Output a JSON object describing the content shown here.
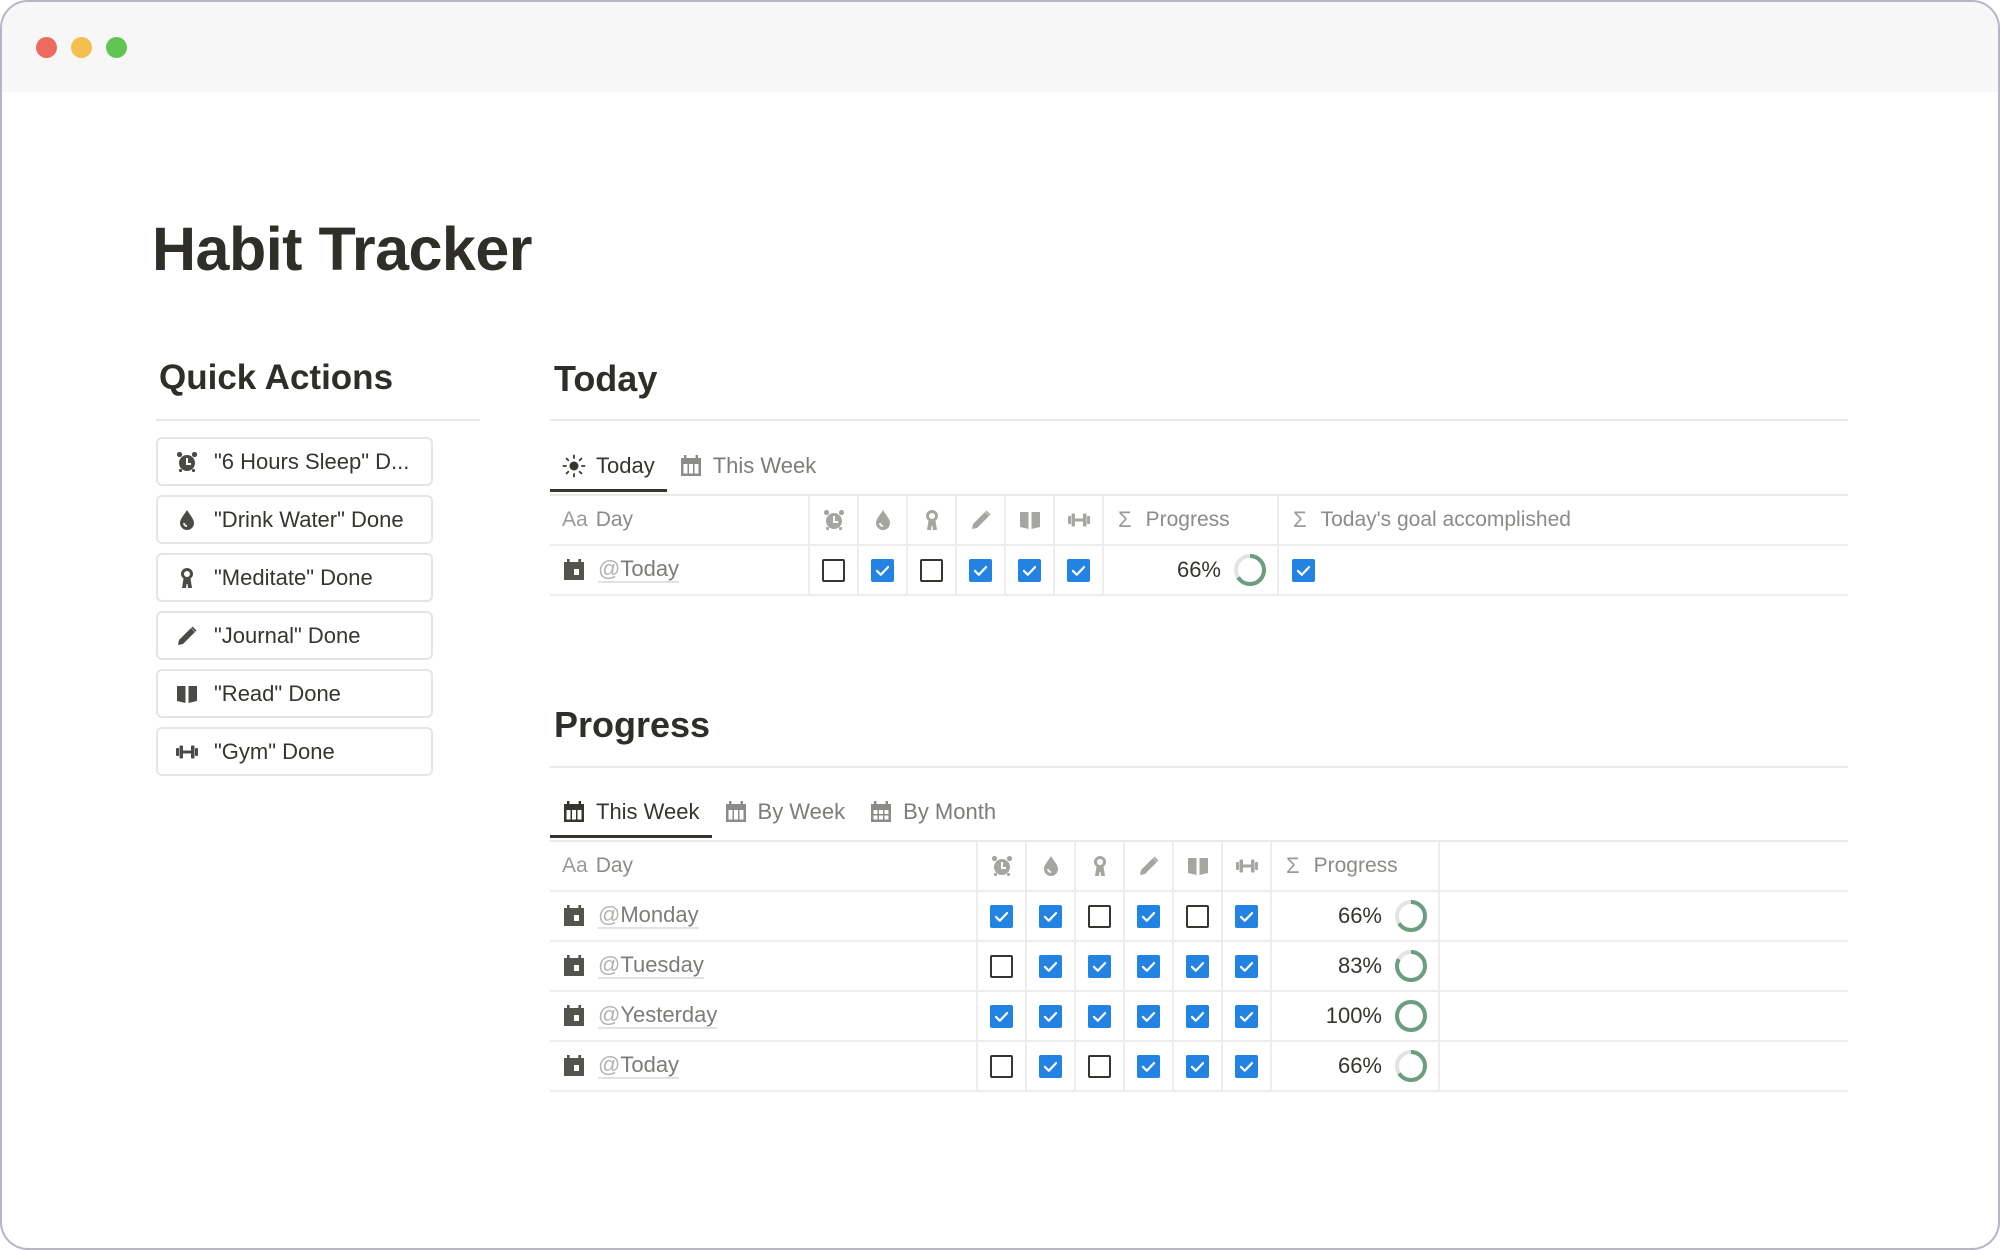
{
  "window": {
    "controls": [
      "close",
      "minimize",
      "maximize"
    ]
  },
  "page": {
    "title": "Habit Tracker"
  },
  "quick_actions": {
    "heading": "Quick Actions",
    "buttons": [
      {
        "label": "\"6 Hours Sleep\" D...",
        "icon": "alarm-clock-icon"
      },
      {
        "label": "\"Drink Water\" Done",
        "icon": "water-drop-icon"
      },
      {
        "label": "\"Meditate\" Done",
        "icon": "meditation-head-icon"
      },
      {
        "label": "\"Journal\" Done",
        "icon": "pencil-icon"
      },
      {
        "label": "\"Read\" Done",
        "icon": "book-icon"
      },
      {
        "label": "\"Gym\" Done",
        "icon": "dumbbell-icon"
      }
    ]
  },
  "habits": [
    {
      "name": "6 Hours Sleep",
      "icon": "alarm-clock-icon"
    },
    {
      "name": "Drink Water",
      "icon": "water-drop-icon"
    },
    {
      "name": "Meditate",
      "icon": "meditation-head-icon"
    },
    {
      "name": "Journal",
      "icon": "pencil-icon"
    },
    {
      "name": "Read",
      "icon": "book-icon"
    },
    {
      "name": "Gym",
      "icon": "dumbbell-icon"
    }
  ],
  "today_section": {
    "heading": "Today",
    "tabs": [
      {
        "label": "Today",
        "icon": "sun-icon",
        "active": true
      },
      {
        "label": "This Week",
        "icon": "calendar-week-icon",
        "active": false
      }
    ],
    "columns": {
      "day": {
        "prefix": "Aa",
        "label": "Day"
      },
      "progress": {
        "prefix": "Σ",
        "label": "Progress"
      },
      "goal": {
        "prefix": "Σ",
        "label": "Today's goal accomplished"
      }
    },
    "rows": [
      {
        "day": "Today",
        "checks": [
          false,
          true,
          false,
          true,
          true,
          true
        ],
        "progress_label": "66%",
        "progress": 0.66,
        "goal_accomplished": true
      }
    ]
  },
  "progress_section": {
    "heading": "Progress",
    "tabs": [
      {
        "label": "This Week",
        "icon": "calendar-week-icon",
        "active": true
      },
      {
        "label": "By Week",
        "icon": "calendar-week-icon",
        "active": false
      },
      {
        "label": "By Month",
        "icon": "calendar-month-icon",
        "active": false
      }
    ],
    "columns": {
      "day": {
        "prefix": "Aa",
        "label": "Day"
      },
      "progress": {
        "prefix": "Σ",
        "label": "Progress"
      }
    },
    "rows": [
      {
        "day": "Monday",
        "checks": [
          true,
          true,
          false,
          true,
          false,
          true
        ],
        "progress_label": "66%",
        "progress": 0.66
      },
      {
        "day": "Tuesday",
        "checks": [
          false,
          true,
          true,
          true,
          true,
          true
        ],
        "progress_label": "83%",
        "progress": 0.83
      },
      {
        "day": "Yesterday",
        "checks": [
          true,
          true,
          true,
          true,
          true,
          true
        ],
        "progress_label": "100%",
        "progress": 1.0
      },
      {
        "day": "Today",
        "checks": [
          false,
          true,
          false,
          true,
          true,
          true
        ],
        "progress_label": "66%",
        "progress": 0.66
      }
    ]
  },
  "colors": {
    "checkbox_on": "#2383e2",
    "ring_fill": "#6a9e7f",
    "ring_track": "#e3e3e1",
    "text": "#37352f"
  }
}
